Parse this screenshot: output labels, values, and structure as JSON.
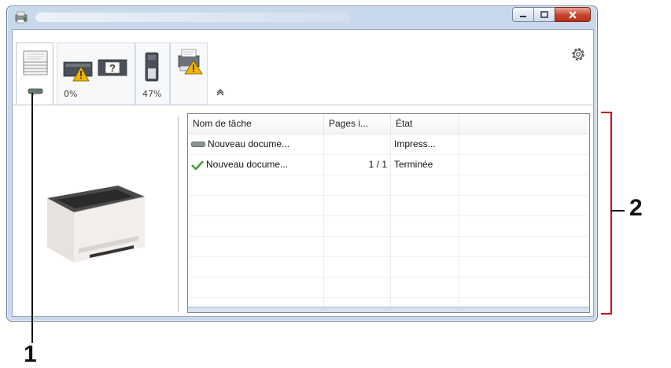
{
  "toolbar": {
    "tabs": [
      {
        "name": "jobs",
        "label": ""
      },
      {
        "name": "toner",
        "label": "0%"
      },
      {
        "name": "paper",
        "label": "47%"
      },
      {
        "name": "device-alert",
        "label": ""
      }
    ]
  },
  "job_table": {
    "headers": [
      "Nom de tâche",
      "Pages i...",
      "État",
      ""
    ],
    "rows": [
      {
        "icon": "in-progress-icon",
        "name": "Nouveau docume...",
        "pages": "",
        "status": "Impress..."
      },
      {
        "icon": "checkmark-icon",
        "name": "Nouveau docume...",
        "pages": "1 / 1",
        "status": "Terminée"
      }
    ],
    "empty_rows": 7
  },
  "callouts": {
    "one": "1",
    "two": "2"
  },
  "colors": {
    "accent_red": "#d0021b",
    "frame": "#c9d9ec",
    "check_green": "#3fa33a"
  },
  "icons": {
    "app": "printer-app-icon",
    "gear": "gear-icon",
    "collapse": "chevron-up-icon",
    "printer": "printer-image"
  }
}
